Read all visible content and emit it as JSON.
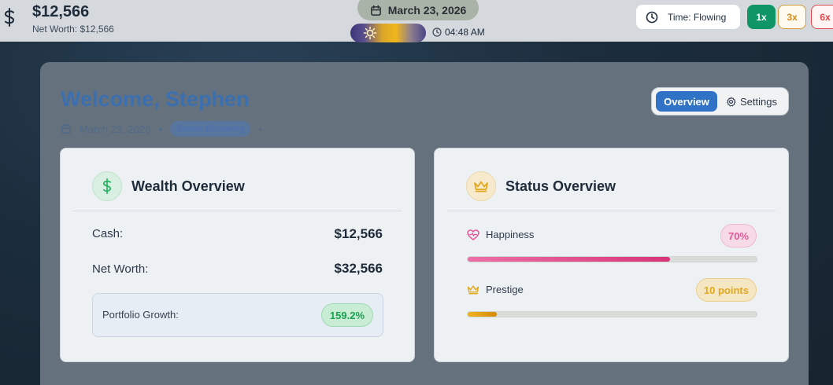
{
  "topbar": {
    "cash": "$12,566",
    "net_worth": "Net Worth: $12,566",
    "date": "March 23, 2026",
    "time": "04:48 AM",
    "time_mode": "Time: Flowing",
    "speeds": [
      "1x",
      "3x",
      "6x"
    ],
    "active_speed": "1x"
  },
  "header": {
    "welcome": "Welcome, Stephen",
    "date": "March 23, 2026",
    "status_badge": "Status Economy",
    "tabs": {
      "overview": "Overview",
      "settings": "Settings"
    },
    "active_tab": "Overview"
  },
  "wealth": {
    "title": "Wealth Overview",
    "cash_label": "Cash:",
    "cash_value": "$12,566",
    "net_label": "Net Worth:",
    "net_value": "$32,566",
    "growth_label": "Portfolio Growth:",
    "growth_value": "159.2%"
  },
  "status": {
    "title": "Status Overview",
    "happiness_label": "Happiness",
    "happiness_value": "70%",
    "happiness_fraction": 0.7,
    "prestige_label": "Prestige",
    "prestige_value": "10 points",
    "prestige_fraction": 0.1
  },
  "colors": {
    "accent": "#2f72c6",
    "positive": "#19a24f",
    "happiness": "#e5559a",
    "prestige": "#e2a81c",
    "speed_active": "#109566"
  },
  "icons": [
    "dollar-icon",
    "calendar-icon",
    "sun-icon",
    "clock-icon",
    "gear-icon",
    "heart-pulse-icon",
    "crown-icon"
  ]
}
